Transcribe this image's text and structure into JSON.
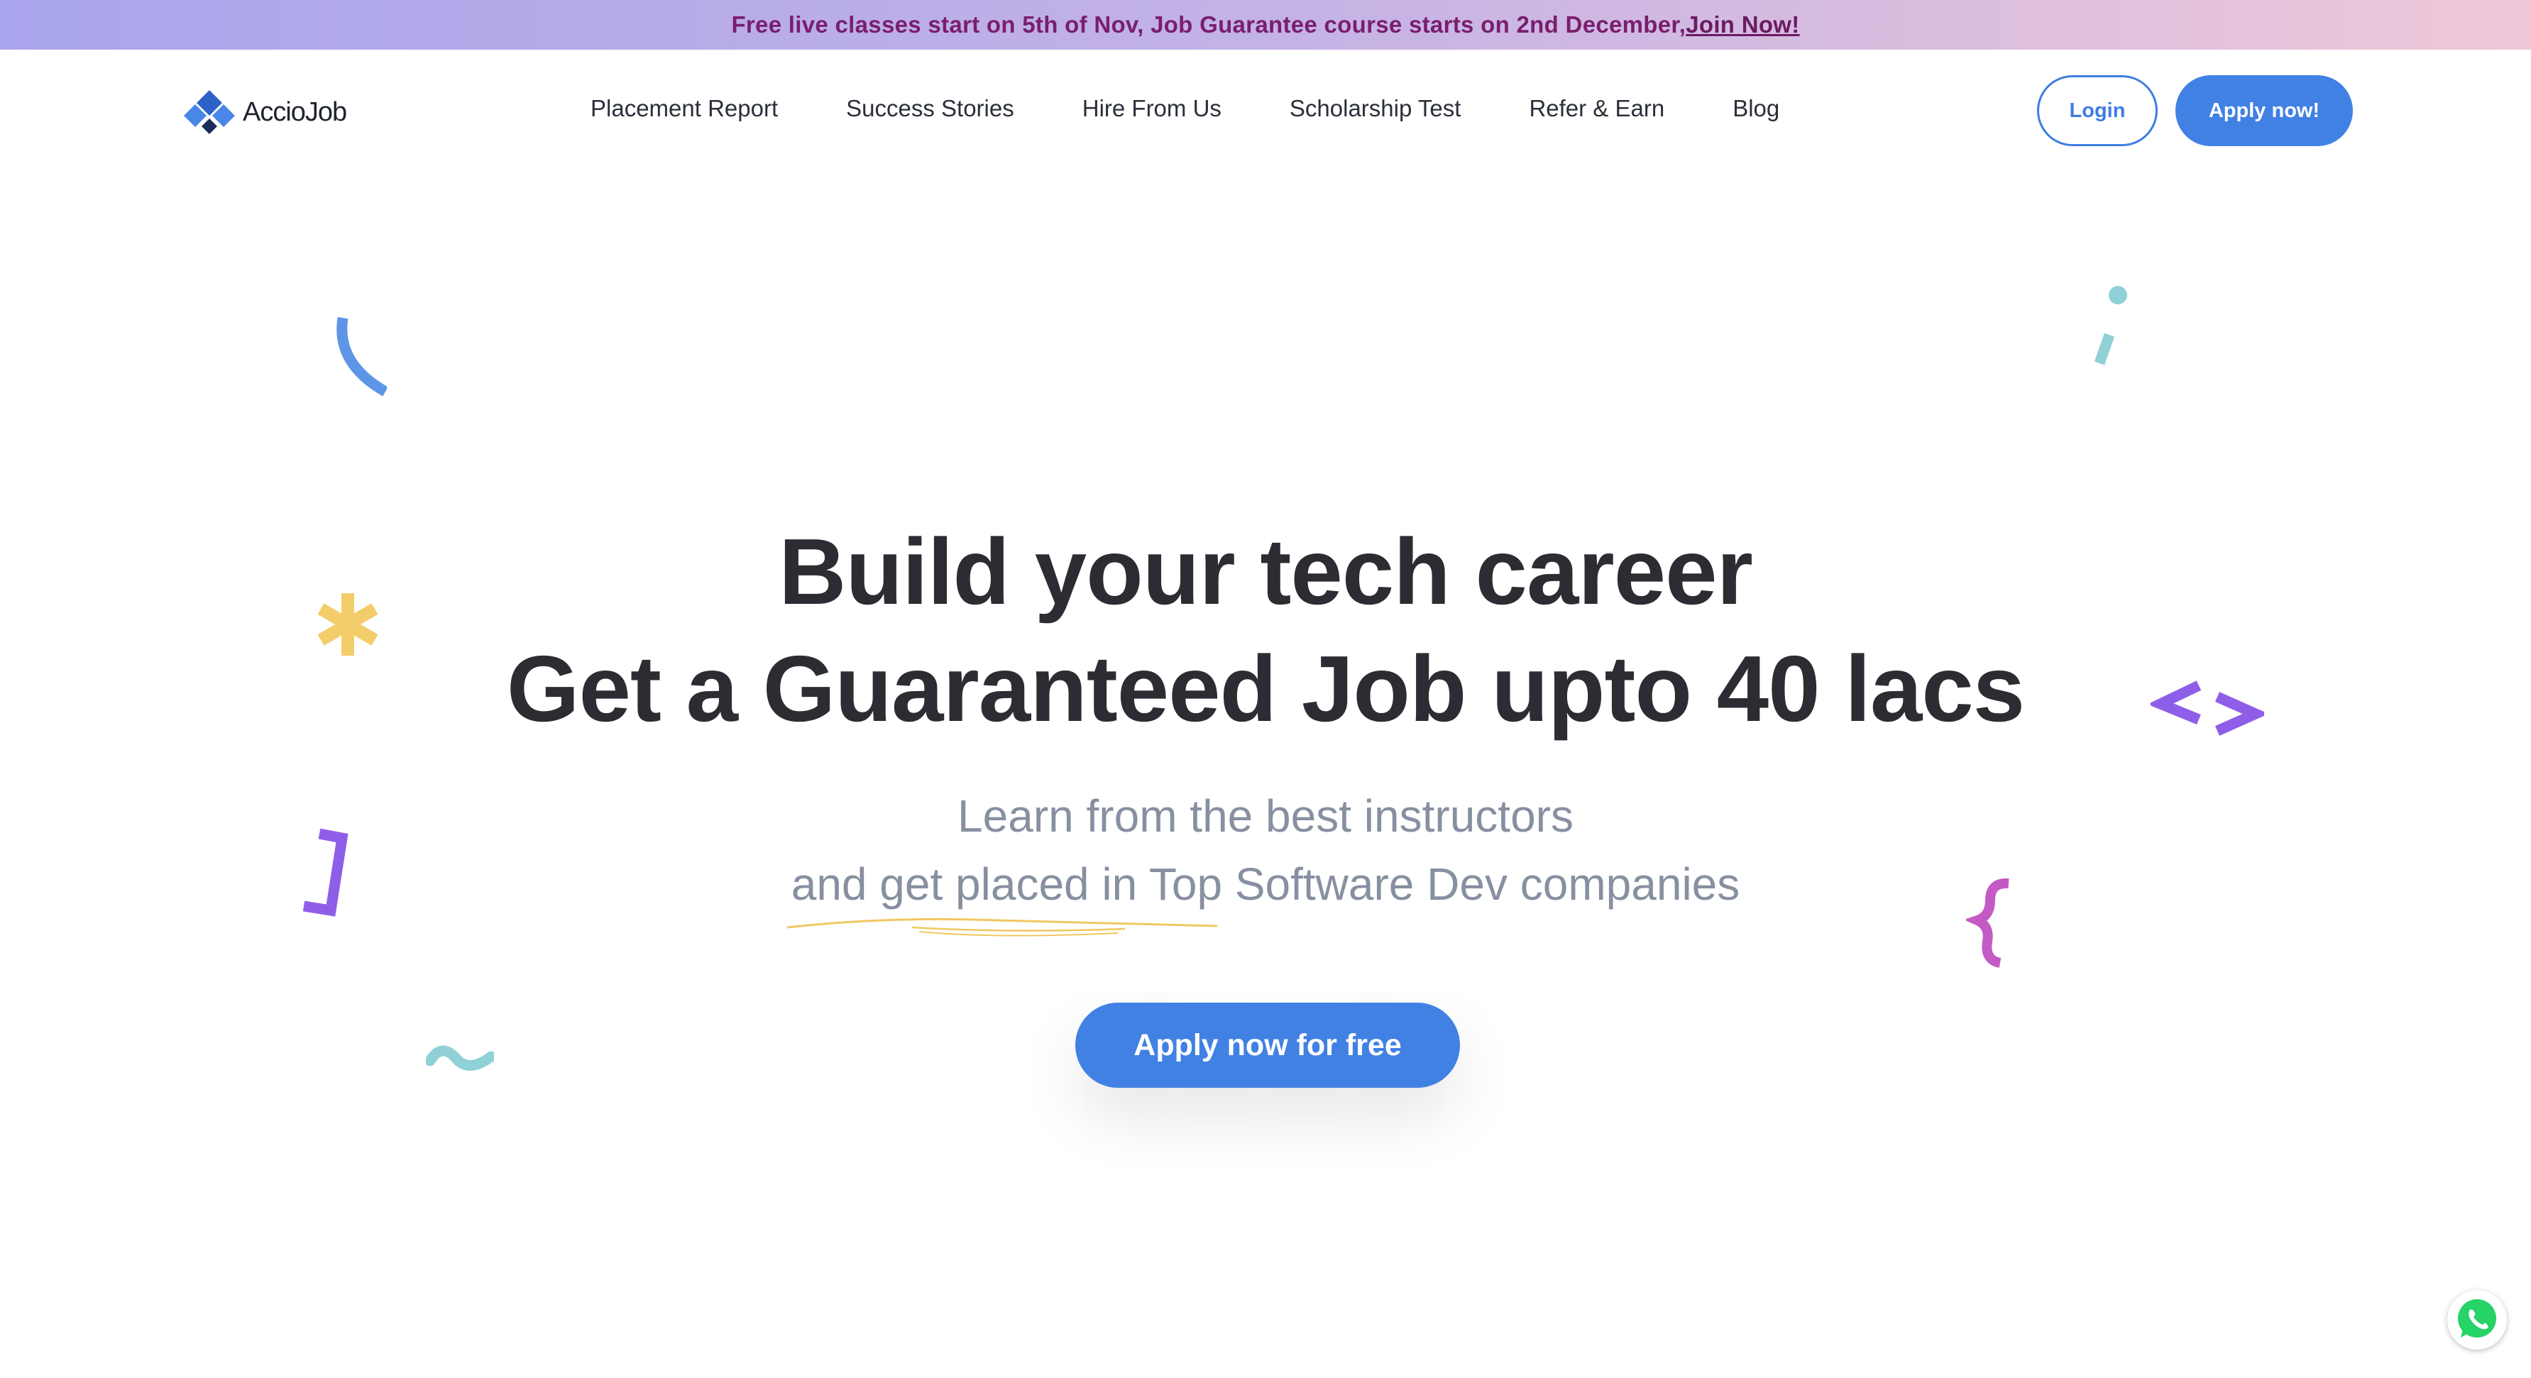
{
  "announcement": {
    "text": "Free live classes start on 5th of Nov, Job Guarantee course starts on 2nd December,",
    "link_label": "Join Now!"
  },
  "brand": {
    "name": "AccioJob",
    "accent_color": "#4181e3"
  },
  "nav": {
    "items": [
      {
        "label": "Placement Report"
      },
      {
        "label": "Success Stories"
      },
      {
        "label": "Hire From Us"
      },
      {
        "label": "Scholarship Test"
      },
      {
        "label": "Refer & Earn"
      },
      {
        "label": "Blog"
      }
    ],
    "login_label": "Login",
    "apply_label": "Apply now!"
  },
  "hero": {
    "title_line1": "Build your tech career",
    "title_line2": "Get a Guaranteed Job upto 40 lacs",
    "subtitle_line1": "Learn from the best instructors",
    "subtitle_line2": "and get placed in Top Software Dev companies",
    "cta_label": "Apply now for free"
  },
  "decorations": {
    "icons": [
      "open-paren-icon",
      "semicolon-icon",
      "asterisk-icon",
      "code-brackets-icon",
      "close-bracket-icon",
      "open-brace-icon",
      "tilde-icon"
    ],
    "colors": {
      "blue": "#5d96e6",
      "teal": "#8fd1d6",
      "yellow": "#f3cd6a",
      "purple": "#8f5ee8",
      "magenta": "#c45bc4"
    }
  },
  "whatsapp": {
    "icon": "whatsapp-icon",
    "color": "#25d366"
  }
}
